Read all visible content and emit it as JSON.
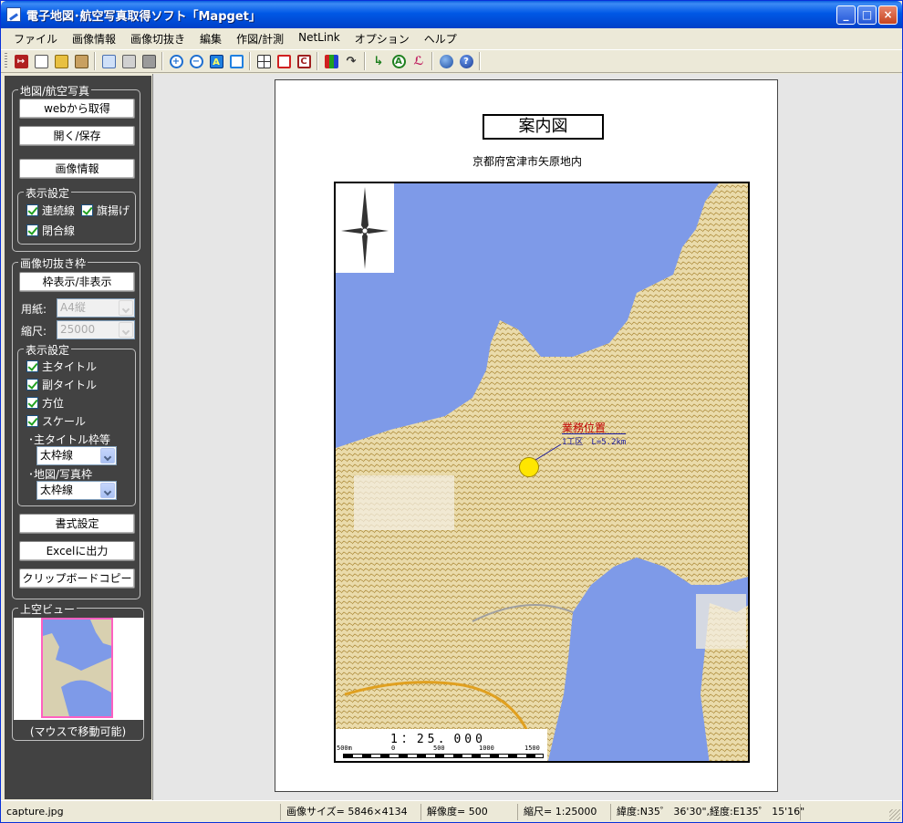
{
  "window": {
    "title": "電子地図･航空写真取得ソフト「Mapget」",
    "controls": [
      "_",
      "□",
      "×"
    ]
  },
  "menu": [
    "ファイル",
    "画像情報",
    "画像切抜き",
    "編集",
    "作図/計測",
    "NetLink",
    "オプション",
    "ヘルプ"
  ],
  "toolbar": {
    "icons": [
      "exit-icon",
      "new-icon",
      "open-icon",
      "save-image-icon",
      "preview-icon",
      "print-icon",
      "disk-icon",
      "zoom-in-icon",
      "zoom-out-icon",
      "fit-icon",
      "frame-icon",
      "grid-icon",
      "rect-icon",
      "copyright-icon",
      "color-bars-icon",
      "rotate-icon",
      "measure-icon",
      "annotate-icon",
      "route-icon",
      "globe-icon",
      "help-icon"
    ]
  },
  "sidebar": {
    "map_group": {
      "title": "地図/航空写真",
      "get_from_web": "webから取得",
      "open_save": "開く/保存",
      "image_info": "画像情報",
      "display_group_title": "表示設定",
      "continuous_line": "連続線",
      "flag": "旗揚げ",
      "closed_line": "閉合線"
    },
    "crop_group": {
      "title": "画像切抜き枠",
      "toggle_frame": "枠表示/非表示",
      "paper_label": "用紙:",
      "paper_value": "A4縦",
      "scale_label": "縮尺:",
      "scale_value": "25000",
      "display_group_title": "表示設定",
      "main_title": "主タイトル",
      "sub_title": "副タイトル",
      "direction": "方位",
      "scale": "スケール",
      "main_title_frame_label": "･主タイトル枠等",
      "main_title_frame_value": "太枠線",
      "map_frame_label": "･地図/写真枠",
      "map_frame_value": "太枠線"
    },
    "format_settings": "書式設定",
    "excel_output": "Excelに出力",
    "clipboard_copy": "クリップボードコピー",
    "overview_group": {
      "title": "上空ビュー",
      "caption": "(マウスで移動可能)"
    }
  },
  "document": {
    "main_title": "案内図",
    "sub_title": "京都府宮津市矢原地内",
    "map_label_title": "業務位置",
    "map_label_sub": "1工区　L=5.2km",
    "scale_ratio": "1：25．000",
    "scale_ticks": [
      "500m",
      "0",
      "500",
      "1000",
      "1500"
    ]
  },
  "status": {
    "file": "capture.jpg",
    "image_size": "画像サイズ= 5846×4134",
    "resolution": "解像度= 500",
    "scale": "縮尺= 1:25000",
    "coords": "緯度:N35゜ 36'30\",経度:E135゜ 15'16\""
  },
  "colors": {
    "title_bar": "#0054e3",
    "panel_bg": "#424242",
    "sea": "#7e9ae8",
    "land": "#e9d9a8",
    "marker": "#ffe600",
    "label_red": "#c00000",
    "overview_frame": "#ff60c0"
  }
}
